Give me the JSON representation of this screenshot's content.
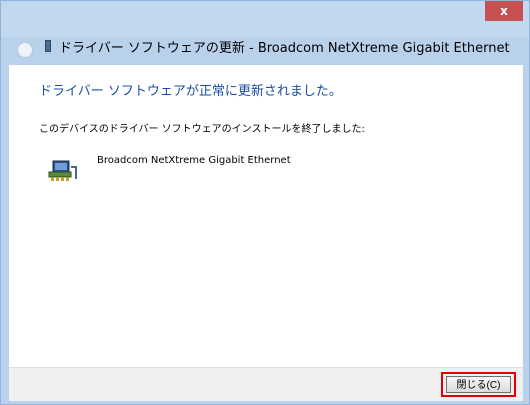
{
  "window": {
    "close_label": "x"
  },
  "wizard": {
    "title": "ドライバー ソフトウェアの更新 - Broadcom NetXtreme Gigabit Ethernet"
  },
  "content": {
    "headline": "ドライバー ソフトウェアが正常に更新されました。",
    "message": "このデバイスのドライバー ソフトウェアのインストールを終了しました:",
    "device_name": "Broadcom NetXtreme Gigabit Ethernet",
    "device_icon": "network-adapter-icon"
  },
  "footer": {
    "close_button_label": "閉じる(C)"
  },
  "colors": {
    "headline": "#1a4fa0",
    "close_button_bg": "#c75050",
    "highlight": "#e00000",
    "titlebar": "#c2d8ee"
  }
}
